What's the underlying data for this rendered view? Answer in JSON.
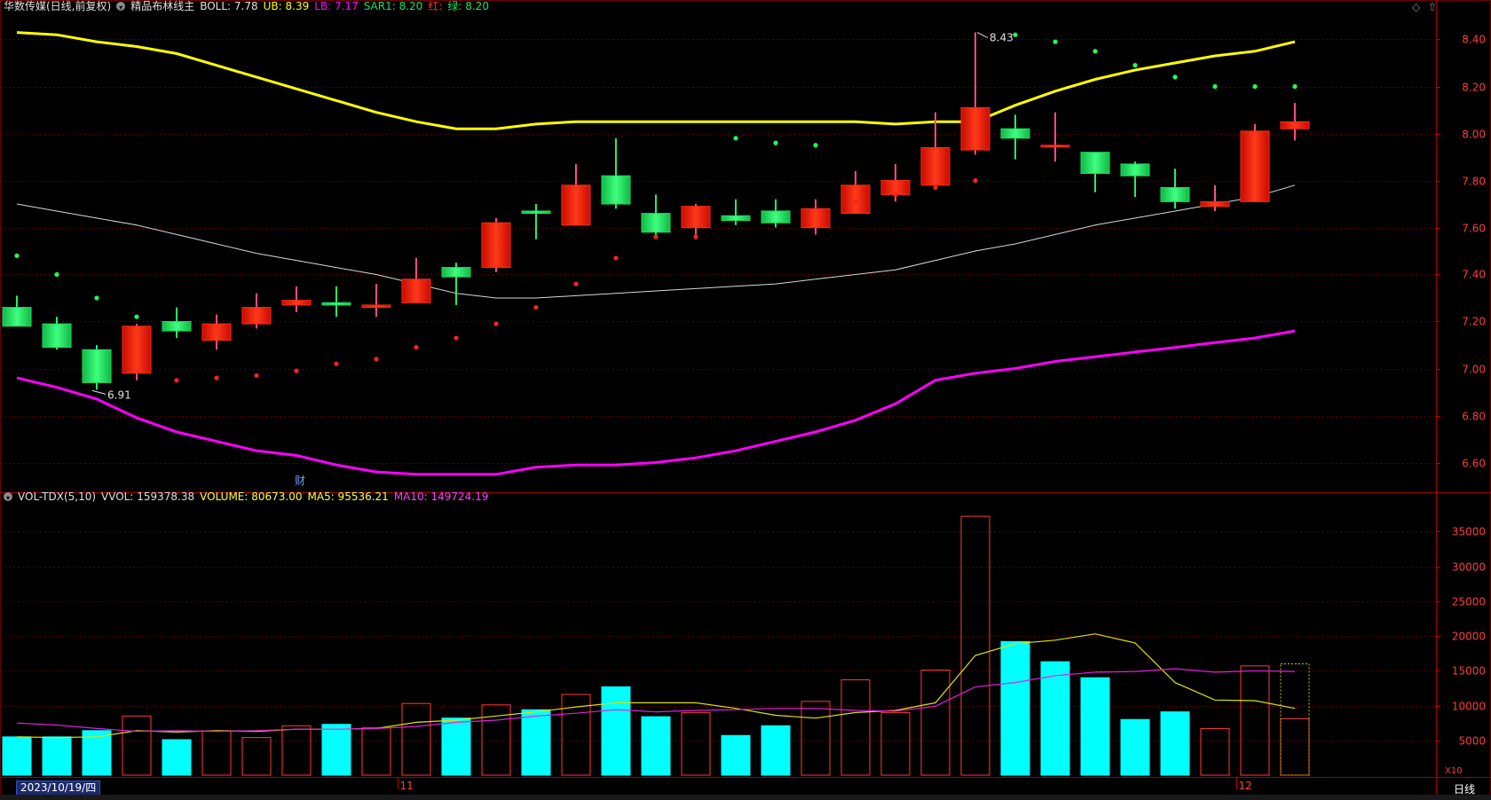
{
  "header": {
    "stock": "华数传媒(日线,前复权)",
    "indicator_name": "精品布林线主",
    "boll": "BOLL: 7.78",
    "ub": "UB: 8.39",
    "lb": "LB: 7.17",
    "sar": "SAR1: 8.20",
    "red": "红:",
    "green": "绿: 8.20"
  },
  "vol_header": {
    "name": "VOL-TDX(5,10)",
    "vvol": "VVOL: 159378.38",
    "volume": "VOLUME: 80673.00",
    "ma5": "MA5: 95536.21",
    "ma10": "MA10: 149724.19"
  },
  "annotations": {
    "high_label": "8.43",
    "low_label": "6.91",
    "event_marker": "财"
  },
  "date_box": "2023/10/19/四",
  "x_marks": [
    "11",
    "12"
  ],
  "x10_label": "X10",
  "period_label": "日线",
  "colors": {
    "up": "#ff2a1a",
    "down": "#18e060",
    "ub": "#ffff00",
    "lb": "#ff00ff",
    "mid": "#d8d8d8",
    "vol_down": "#00ffff",
    "vol_up": "#ff3a3a",
    "ma5": "#e0e000",
    "ma10": "#e020e0",
    "grid": "#5a0000"
  },
  "chart_data": [
    {
      "type": "candlestick",
      "title": "精品布林线主",
      "ylim": [
        6.5,
        8.5
      ],
      "y_ticks": [
        "8.40",
        "8.20",
        "8.00",
        "7.80",
        "7.60",
        "7.40",
        "7.20",
        "7.00",
        "6.80",
        "6.60"
      ],
      "candles": [
        {
          "o": 7.26,
          "h": 7.31,
          "l": 7.18,
          "c": 7.18
        },
        {
          "o": 7.19,
          "h": 7.22,
          "l": 7.08,
          "c": 7.09
        },
        {
          "o": 7.08,
          "h": 7.1,
          "l": 6.91,
          "c": 6.94
        },
        {
          "o": 6.98,
          "h": 7.19,
          "l": 6.95,
          "c": 7.18
        },
        {
          "o": 7.2,
          "h": 7.26,
          "l": 7.13,
          "c": 7.16
        },
        {
          "o": 7.12,
          "h": 7.23,
          "l": 7.08,
          "c": 7.19
        },
        {
          "o": 7.19,
          "h": 7.32,
          "l": 7.17,
          "c": 7.26
        },
        {
          "o": 7.27,
          "h": 7.35,
          "l": 7.24,
          "c": 7.29
        },
        {
          "o": 7.28,
          "h": 7.35,
          "l": 7.22,
          "c": 7.27
        },
        {
          "o": 7.26,
          "h": 7.36,
          "l": 7.22,
          "c": 7.27
        },
        {
          "o": 7.28,
          "h": 7.47,
          "l": 7.28,
          "c": 7.38
        },
        {
          "o": 7.43,
          "h": 7.45,
          "l": 7.27,
          "c": 7.39
        },
        {
          "o": 7.43,
          "h": 7.64,
          "l": 7.41,
          "c": 7.62
        },
        {
          "o": 7.67,
          "h": 7.7,
          "l": 7.55,
          "c": 7.66
        },
        {
          "o": 7.61,
          "h": 7.87,
          "l": 7.61,
          "c": 7.78
        },
        {
          "o": 7.82,
          "h": 7.98,
          "l": 7.68,
          "c": 7.7
        },
        {
          "o": 7.66,
          "h": 7.74,
          "l": 7.56,
          "c": 7.58
        },
        {
          "o": 7.6,
          "h": 7.7,
          "l": 7.55,
          "c": 7.69
        },
        {
          "o": 7.65,
          "h": 7.72,
          "l": 7.61,
          "c": 7.63
        },
        {
          "o": 7.67,
          "h": 7.72,
          "l": 7.6,
          "c": 7.62
        },
        {
          "o": 7.6,
          "h": 7.72,
          "l": 7.57,
          "c": 7.68
        },
        {
          "o": 7.66,
          "h": 7.84,
          "l": 7.66,
          "c": 7.78
        },
        {
          "o": 7.74,
          "h": 7.87,
          "l": 7.71,
          "c": 7.8
        },
        {
          "o": 7.78,
          "h": 8.09,
          "l": 7.78,
          "c": 7.94
        },
        {
          "o": 7.93,
          "h": 8.43,
          "l": 7.91,
          "c": 8.11
        },
        {
          "o": 8.02,
          "h": 8.08,
          "l": 7.89,
          "c": 7.98
        },
        {
          "o": 7.95,
          "h": 8.09,
          "l": 7.88,
          "c": 7.95
        },
        {
          "o": 7.92,
          "h": 7.92,
          "l": 7.75,
          "c": 7.83
        },
        {
          "o": 7.87,
          "h": 7.88,
          "l": 7.73,
          "c": 7.82
        },
        {
          "o": 7.77,
          "h": 7.85,
          "l": 7.68,
          "c": 7.71
        },
        {
          "o": 7.69,
          "h": 7.78,
          "l": 7.67,
          "c": 7.71
        },
        {
          "o": 7.71,
          "h": 8.04,
          "l": 7.71,
          "c": 8.01
        },
        {
          "o": 8.02,
          "h": 8.13,
          "l": 7.97,
          "c": 8.05
        }
      ],
      "ub": [
        8.43,
        8.42,
        8.39,
        8.37,
        8.34,
        8.29,
        8.24,
        8.19,
        8.14,
        8.09,
        8.05,
        8.02,
        8.02,
        8.04,
        8.05,
        8.05,
        8.05,
        8.05,
        8.05,
        8.05,
        8.05,
        8.05,
        8.04,
        8.05,
        8.05,
        8.12,
        8.18,
        8.23,
        8.27,
        8.3,
        8.33,
        8.35,
        8.39
      ],
      "mid": [
        7.7,
        7.67,
        7.64,
        7.61,
        7.57,
        7.53,
        7.49,
        7.46,
        7.43,
        7.4,
        7.36,
        7.32,
        7.3,
        7.3,
        7.31,
        7.32,
        7.33,
        7.34,
        7.35,
        7.36,
        7.38,
        7.4,
        7.42,
        7.46,
        7.5,
        7.53,
        7.57,
        7.61,
        7.64,
        7.67,
        7.7,
        7.73,
        7.78
      ],
      "lb": [
        6.96,
        6.92,
        6.87,
        6.79,
        6.73,
        6.69,
        6.65,
        6.63,
        6.59,
        6.56,
        6.55,
        6.55,
        6.55,
        6.58,
        6.59,
        6.59,
        6.6,
        6.62,
        6.65,
        6.69,
        6.73,
        6.78,
        6.85,
        6.95,
        6.98,
        7.0,
        7.03,
        7.05,
        7.07,
        7.09,
        7.11,
        7.13,
        7.16
      ],
      "sar": [
        7.48,
        7.4,
        7.3,
        7.22,
        6.95,
        6.96,
        6.97,
        6.99,
        7.02,
        7.04,
        7.09,
        7.13,
        7.19,
        7.26,
        7.36,
        7.47,
        7.56,
        7.56,
        7.98,
        7.96,
        7.95,
        7.71,
        7.74,
        7.77,
        7.8,
        8.42,
        8.39,
        8.35,
        8.29,
        8.24,
        8.2,
        8.2,
        8.2
      ],
      "sar_up": [
        false,
        false,
        false,
        false,
        true,
        true,
        true,
        true,
        true,
        true,
        true,
        true,
        true,
        true,
        true,
        true,
        true,
        true,
        false,
        false,
        false,
        true,
        true,
        true,
        true,
        false,
        false,
        false,
        false,
        false,
        false,
        false,
        false
      ]
    },
    {
      "type": "bar",
      "title": "VOL-TDX(5,10)",
      "ylim": [
        0,
        39000
      ],
      "y_ticks": [
        "35000",
        "30000",
        "25000",
        "20000",
        "15000",
        "10000",
        "5000"
      ],
      "values": [
        5500,
        5500,
        6400,
        8500,
        5100,
        6300,
        5400,
        7100,
        7300,
        6800,
        10300,
        8200,
        10100,
        9400,
        11600,
        12700,
        8400,
        9000,
        5700,
        7100,
        10600,
        13700,
        9000,
        15100,
        37200,
        19200,
        16300,
        14000,
        8000,
        9100,
        6700,
        15700,
        8100
      ],
      "direction": [
        "down",
        "down",
        "down",
        "up",
        "down",
        "up",
        "up",
        "up",
        "down",
        "up",
        "up",
        "down",
        "up",
        "down",
        "up",
        "down",
        "down",
        "up",
        "down",
        "down",
        "up",
        "up",
        "up",
        "up",
        "up",
        "down",
        "down",
        "down",
        "down",
        "down",
        "up",
        "up",
        "up"
      ],
      "ma5": [
        5500,
        5400,
        5500,
        6400,
        6200,
        6400,
        6300,
        6600,
        6600,
        6700,
        7600,
        7900,
        8500,
        9100,
        9800,
        10400,
        10400,
        10400,
        9600,
        8600,
        8200,
        9000,
        9300,
        10400,
        17200,
        18900,
        19400,
        20300,
        19000,
        13300,
        10800,
        10700,
        9600
      ],
      "ma10": [
        7500,
        7200,
        6700,
        6300,
        6400,
        6300,
        6400,
        6600,
        6600,
        6700,
        7000,
        7600,
        7900,
        8500,
        8900,
        9400,
        9100,
        9300,
        9400,
        9600,
        9600,
        9300,
        9200,
        9900,
        12700,
        13300,
        14300,
        14800,
        14900,
        15300,
        14800,
        15000,
        14900
      ]
    }
  ]
}
